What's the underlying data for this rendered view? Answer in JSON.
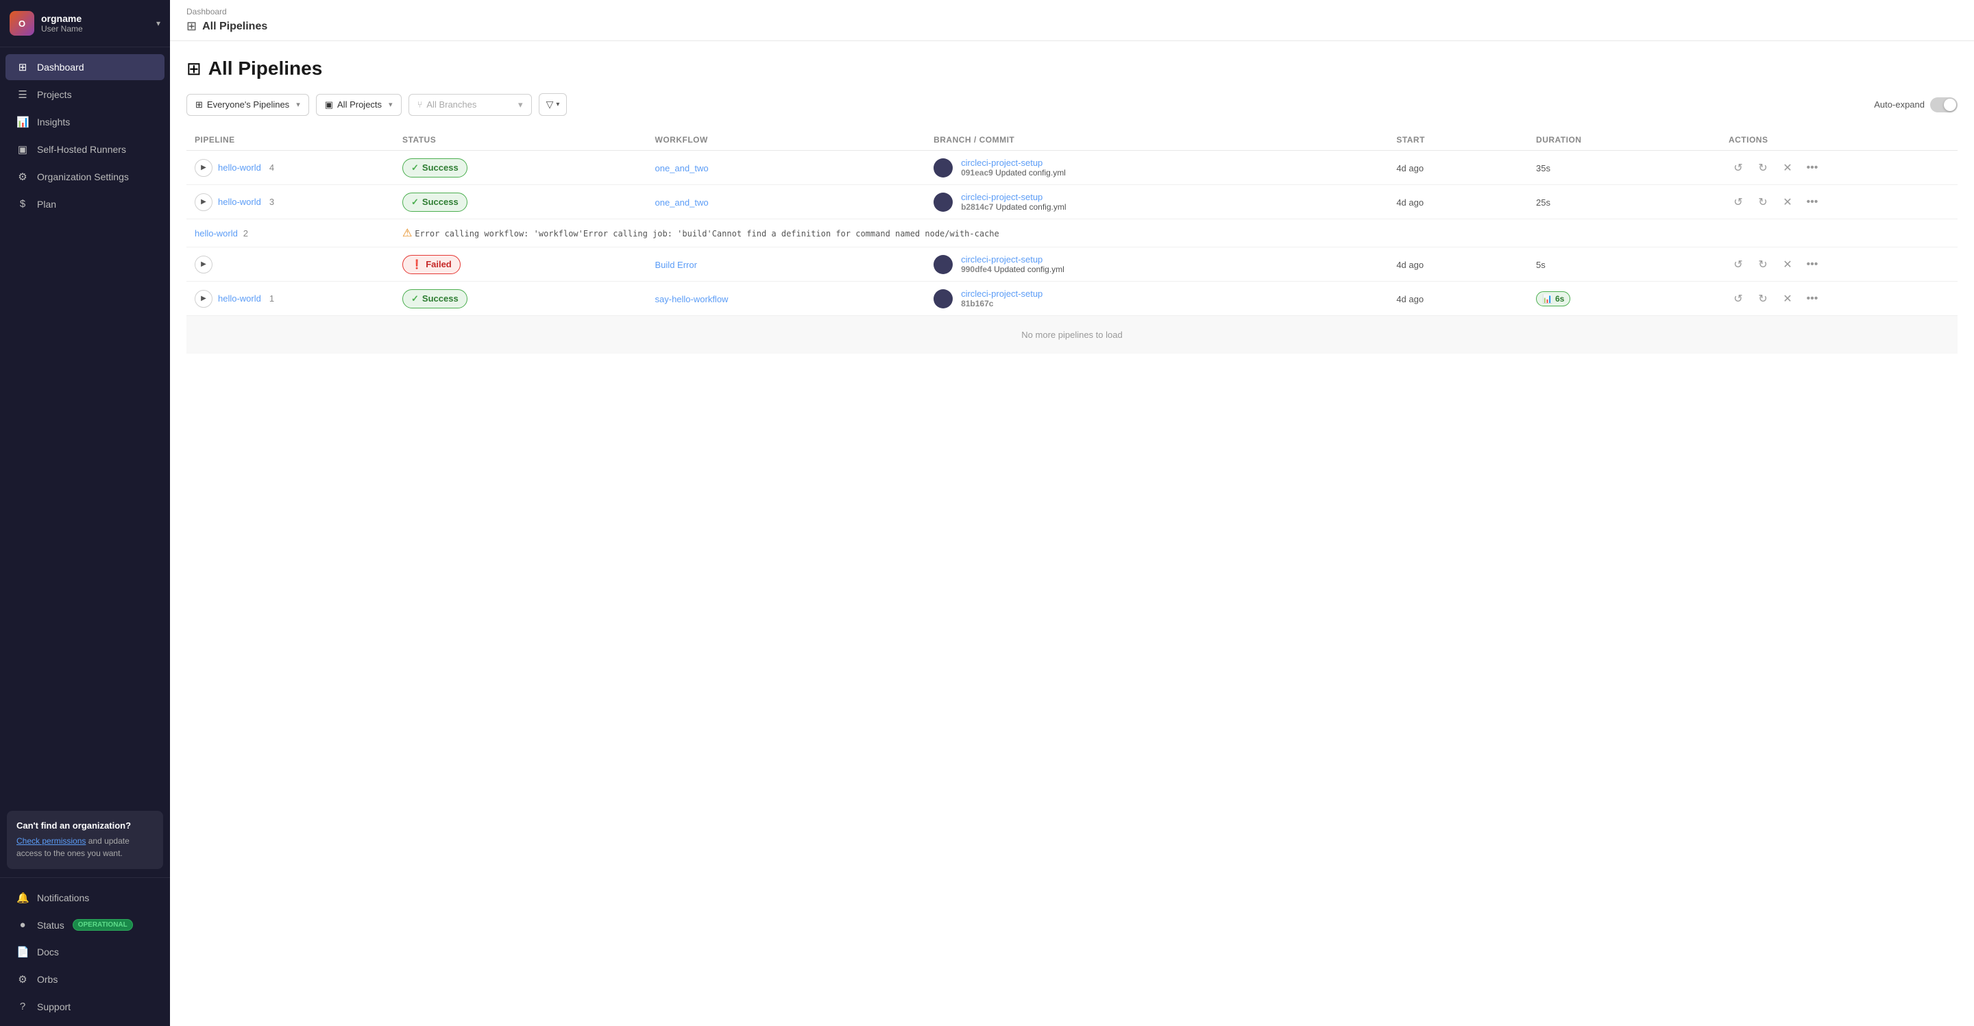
{
  "sidebar": {
    "org": {
      "name": "orgname",
      "user": "User Name"
    },
    "nav_items": [
      {
        "id": "dashboard",
        "label": "Dashboard",
        "icon": "⊞",
        "active": true
      },
      {
        "id": "projects",
        "label": "Projects",
        "icon": "☰"
      },
      {
        "id": "insights",
        "label": "Insights",
        "icon": "📊"
      },
      {
        "id": "self-hosted-runners",
        "label": "Self-Hosted Runners",
        "icon": "▣"
      },
      {
        "id": "organization-settings",
        "label": "Organization Settings",
        "icon": "⚙"
      },
      {
        "id": "plan",
        "label": "Plan",
        "icon": "$"
      }
    ],
    "cant_find": {
      "title": "Can't find an organization?",
      "link_text": "Check permissions",
      "desc": " and update access to the ones you want."
    },
    "bottom_items": [
      {
        "id": "notifications",
        "label": "Notifications",
        "icon": "🔔"
      },
      {
        "id": "status",
        "label": "Status",
        "badge": "OPERATIONAL"
      },
      {
        "id": "docs",
        "label": "Docs",
        "icon": "📄"
      },
      {
        "id": "orbs",
        "label": "Orbs",
        "icon": "⚙"
      },
      {
        "id": "support",
        "label": "Support",
        "icon": "?"
      }
    ]
  },
  "header": {
    "breadcrumb": "Dashboard",
    "page_title": "All Pipelines",
    "page_icon": "⊞"
  },
  "filters": {
    "pipelines_dropdown": "Everyone's Pipelines",
    "projects_dropdown": "All Projects",
    "branches_placeholder": "All Branches",
    "auto_expand_label": "Auto-expand"
  },
  "table": {
    "columns": [
      "Pipeline",
      "Status",
      "Workflow",
      "Branch / Commit",
      "Start",
      "Duration",
      "Actions"
    ],
    "rows": [
      {
        "id": "row1",
        "pipeline_name": "hello-world",
        "pipeline_num": "4",
        "status": "Success",
        "status_type": "success",
        "workflow": "one_and_two",
        "branch_name": "circleci-project-setup",
        "commit_hash": "091eac9",
        "commit_msg": "Updated config.yml",
        "start": "4d ago",
        "duration": "35s",
        "duration_type": "text"
      },
      {
        "id": "row2",
        "pipeline_name": "hello-world",
        "pipeline_num": "3",
        "status": "Success",
        "status_type": "success",
        "workflow": "one_and_two",
        "branch_name": "circleci-project-setup",
        "commit_hash": "b2814c7",
        "commit_msg": "Updated config.yml",
        "start": "4d ago",
        "duration": "25s",
        "duration_type": "text"
      },
      {
        "id": "row3",
        "pipeline_name": "hello-world",
        "pipeline_num": "2",
        "status": "Failed",
        "status_type": "failed",
        "workflow": "Build Error",
        "branch_name": "circleci-project-setup",
        "commit_hash": "990dfe4",
        "commit_msg": "Updated config.yml",
        "start": "4d ago",
        "duration": "5s",
        "duration_type": "text",
        "error_msg": "Error calling workflow: 'workflow'Error calling job: 'build'Cannot find a definition for command named node/with-cache"
      },
      {
        "id": "row4",
        "pipeline_name": "hello-world",
        "pipeline_num": "1",
        "status": "Success",
        "status_type": "success",
        "workflow": "say-hello-workflow",
        "branch_name": "circleci-project-setup",
        "commit_hash": "81b167c",
        "commit_msg": "",
        "start": "4d ago",
        "duration": "6s",
        "duration_type": "badge"
      }
    ],
    "no_more_label": "No more pipelines to load"
  }
}
